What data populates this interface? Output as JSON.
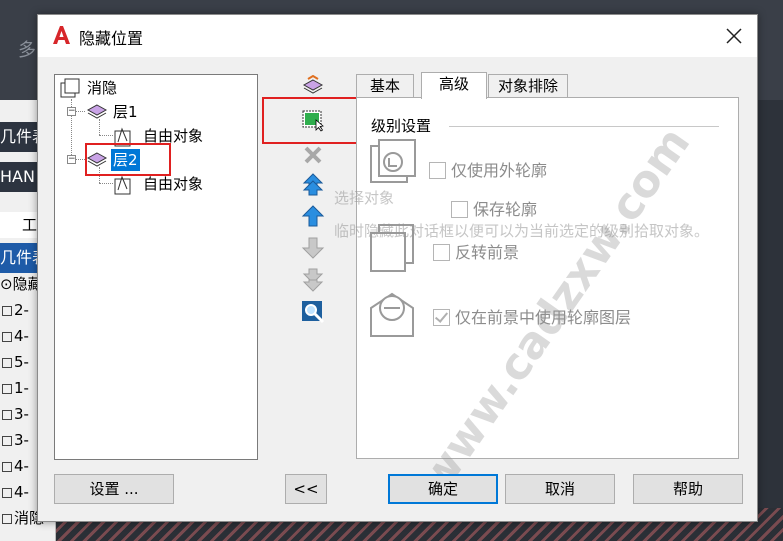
{
  "background": {
    "top_text": "多",
    "left_header_1": "几件表",
    "left_header_2": "HAN",
    "left_header_3": "工",
    "left_header_4": "几件表",
    "left_rows": [
      "⊙隐藏",
      "2-",
      "4-",
      "5-",
      "1-",
      "3-",
      "3-",
      "4-",
      "4-",
      "消隐"
    ]
  },
  "dialog": {
    "title": "隐藏位置",
    "tree": {
      "root": "消隐",
      "layer1": "层1",
      "layer1_child": "自由对象",
      "layer2": "层2",
      "layer2_child": "自由对象"
    },
    "tabs": [
      "基本",
      "高级",
      "对象排除"
    ],
    "active_tab": "高级",
    "panel": {
      "group_label": "级别设置",
      "options": {
        "use_outer_contour": "仅使用外轮廓",
        "keep_contour": "保存轮廓",
        "reverse_foreground": "反转前景",
        "use_contour_layer": "仅在前景中使用轮廓图层"
      }
    },
    "watermark": "www.cadzxw.com",
    "ghost_text_1": "选择对象",
    "ghost_text_2": "临时隐藏此对话框以便可以为当前选定的级别拾取对象。",
    "buttons": {
      "settings": "设置 ...",
      "collapse": "<<",
      "ok": "确定",
      "cancel": "取消",
      "help": "帮助"
    }
  },
  "colors": {
    "accent": "#0078d7",
    "highlight_box": "#e02020",
    "disabled_text": "#8c8c8c"
  }
}
